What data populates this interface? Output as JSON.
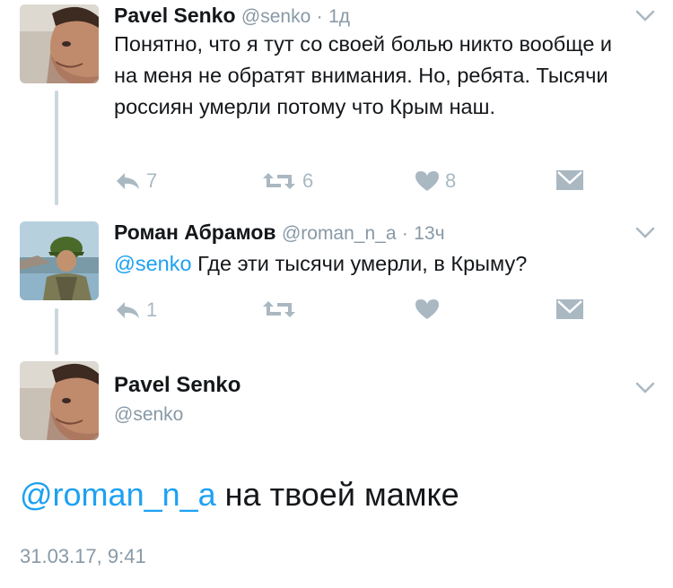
{
  "tweet1": {
    "name": "Pavel Senko",
    "handle": "@senko",
    "dot": "·",
    "time": "1д",
    "text": "Понятно, что я тут со своей болью никто вообще и на меня не обратят внимания. Но, ребята. Тысячи россиян умерли потому что Крым наш.",
    "reply_count": "7",
    "retweet_count": "6",
    "like_count": "8"
  },
  "tweet2": {
    "name": "Роман Абрамов",
    "handle": "@roman_n_a",
    "dot": "·",
    "time": "13ч",
    "mention": "@senko",
    "text": " Где эти тысячи умерли, в Крыму?",
    "reply_count": "1"
  },
  "main_tweet": {
    "name": "Pavel Senko",
    "handle": "@senko",
    "mention": "@roman_n_a",
    "text": " на твоей мамке",
    "date": "31.03.17, 9:41"
  },
  "icons": {
    "reply": "reply-icon",
    "retweet": "retweet-icon",
    "like": "heart-icon",
    "dm": "envelope-icon",
    "menu": "chevron-down-icon"
  },
  "colors": {
    "link": "#1da1f2",
    "muted": "#8899a6",
    "action": "#aab8c2",
    "thread": "#ccd6dd"
  }
}
